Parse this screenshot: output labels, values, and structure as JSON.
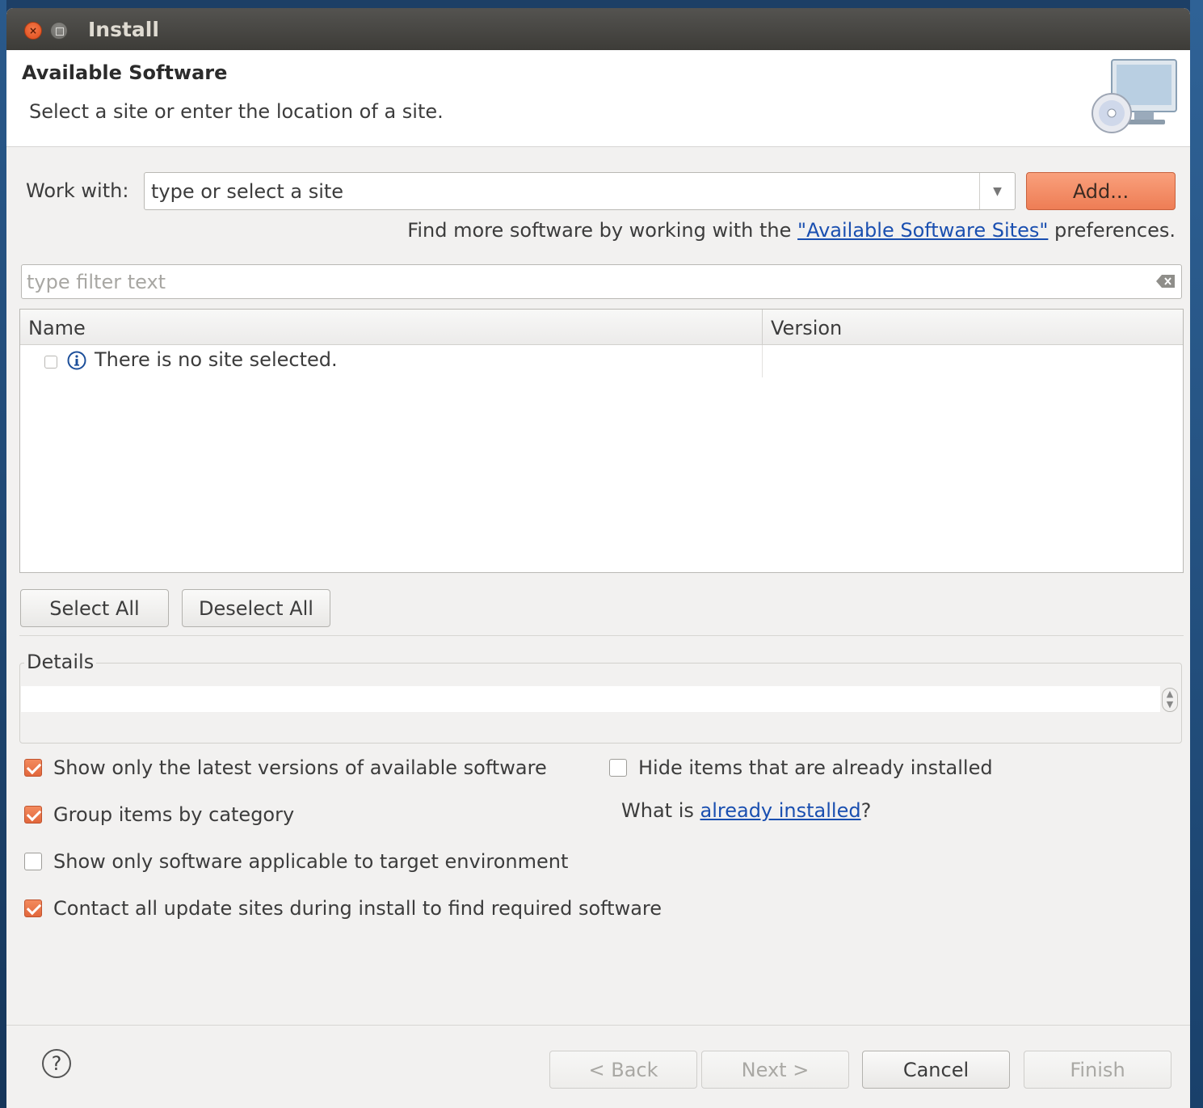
{
  "window": {
    "title": "Install"
  },
  "banner": {
    "title": "Available Software",
    "description": "Select a site or enter the location of a site.",
    "icon": "computer-disc-icon"
  },
  "work_with": {
    "label": "Work with:",
    "value": "type or select a site",
    "add_label": "Add..."
  },
  "find_more": {
    "prefix": "Find more software by working with the ",
    "link": "\"Available Software Sites\"",
    "suffix": " preferences."
  },
  "filter": {
    "placeholder": "type filter text"
  },
  "table": {
    "columns": [
      "Name",
      "Version"
    ],
    "rows": [
      {
        "name": "There is no site selected.",
        "version": ""
      }
    ]
  },
  "selection_buttons": {
    "select_all": "Select All",
    "deselect_all": "Deselect All"
  },
  "details": {
    "label": "Details",
    "text": ""
  },
  "options": {
    "latest_versions": {
      "label": "Show only the latest versions of available software",
      "checked": true
    },
    "group_by_category": {
      "label": "Group items by category",
      "checked": true
    },
    "target_env": {
      "label": "Show only software applicable to target environment",
      "checked": false
    },
    "contact_sites": {
      "label": "Contact all update sites during install to find required software",
      "checked": true
    },
    "hide_installed": {
      "label": "Hide items that are already installed",
      "checked": false
    }
  },
  "installed": {
    "prefix": "What is ",
    "link": "already installed",
    "suffix": "?"
  },
  "footer": {
    "help": "?",
    "back": "< Back",
    "next": "Next >",
    "cancel": "Cancel",
    "finish": "Finish"
  },
  "colors": {
    "accent": "#ee7d55",
    "link": "#1a4fb0",
    "titlebar": "#3d3c38",
    "background": "#f2f1f0"
  }
}
